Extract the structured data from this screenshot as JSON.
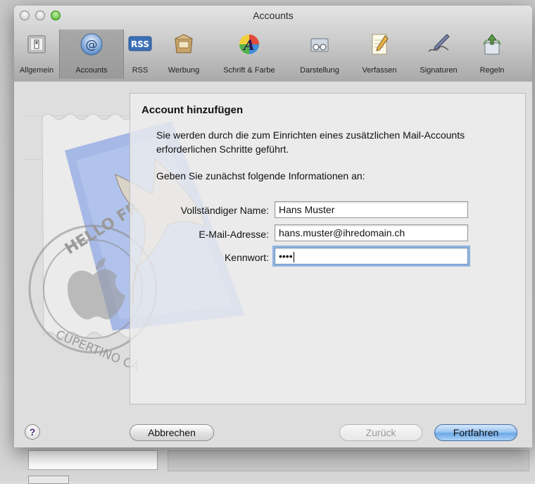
{
  "window": {
    "title": "Accounts"
  },
  "toolbar": {
    "items": [
      {
        "label": "Allgemein",
        "icon": "switch-icon"
      },
      {
        "label": "Accounts",
        "icon": "at-sign-icon"
      },
      {
        "label": "RSS",
        "icon": "rss-icon"
      },
      {
        "label": "Werbung",
        "icon": "junk-mail-icon"
      },
      {
        "label": "Schrift & Farbe",
        "icon": "font-color-icon"
      },
      {
        "label": "Darstellung",
        "icon": "glasses-icon"
      },
      {
        "label": "Verfassen",
        "icon": "compose-pencil-icon"
      },
      {
        "label": "Signaturen",
        "icon": "signature-pen-icon"
      },
      {
        "label": "Regeln",
        "icon": "rules-icon"
      }
    ],
    "selected": "Accounts"
  },
  "sheet": {
    "title": "Account hinzufügen",
    "description": "Sie werden durch die zum Einrichten eines zusätzlichen Mail-Accounts erforderlichen Schritte geführt.",
    "instruction": "Geben Sie zunächst folgende Informationen an:",
    "fields": {
      "full_name": {
        "label": "Vollständiger Name:",
        "value": "Hans Muster"
      },
      "email": {
        "label": "E-Mail-Adresse:",
        "value": "hans.muster@ihredomain.ch"
      },
      "password": {
        "label": "Kennwort:",
        "value": "••••"
      }
    },
    "buttons": {
      "help": "?",
      "cancel": "Abbrechen",
      "back": "Zurück",
      "continue": "Fortfahren"
    },
    "stamp_text": {
      "top": "HELLO FR",
      "bottom": "CUPERTINO CA"
    }
  },
  "colors": {
    "accent": "#6ea9e6",
    "focus_ring": "#76a2da",
    "zoom_button": "#3fae22"
  }
}
